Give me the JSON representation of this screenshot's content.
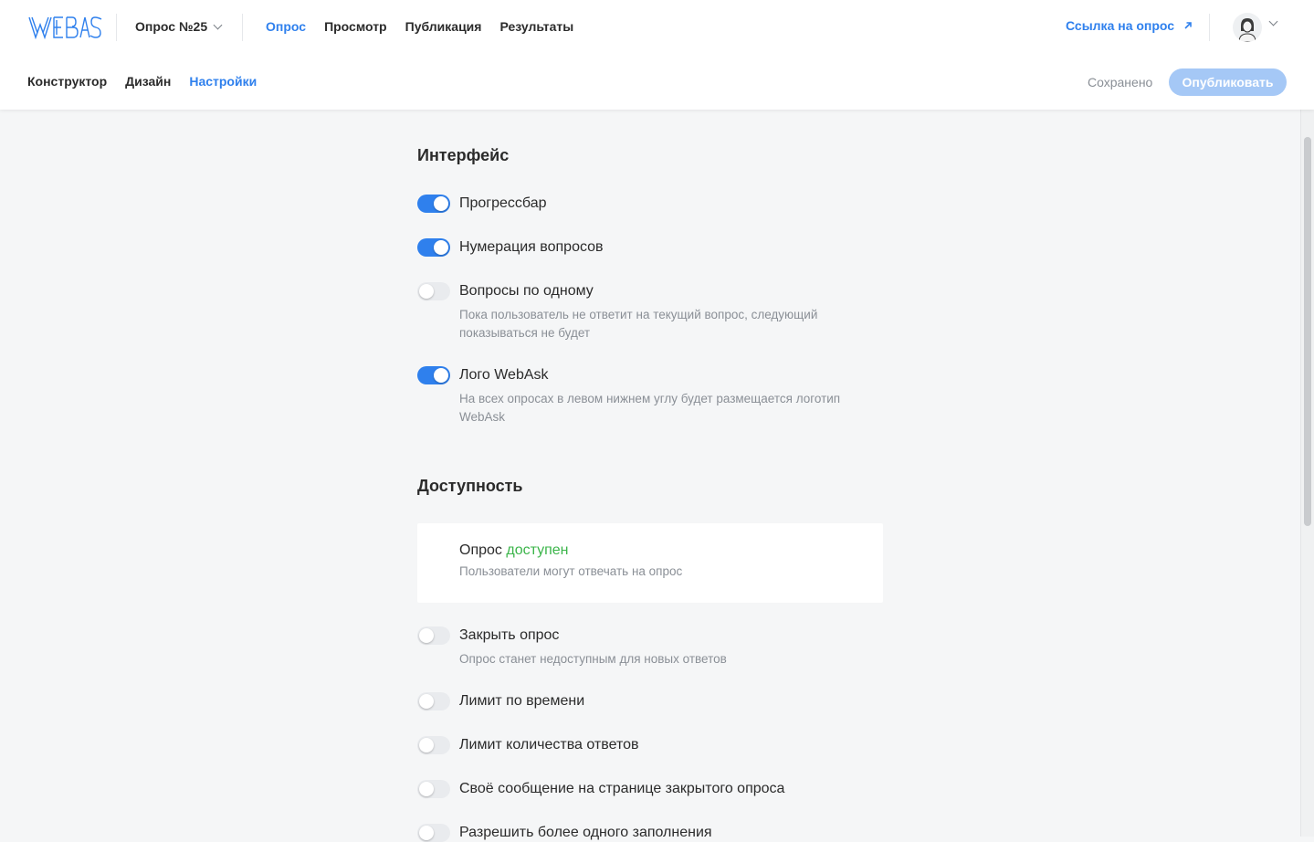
{
  "header": {
    "survey_name": "Опрос №25",
    "nav_tabs": [
      {
        "label": "Опрос",
        "active": true
      },
      {
        "label": "Просмотр",
        "active": false
      },
      {
        "label": "Публикация",
        "active": false
      },
      {
        "label": "Результаты",
        "active": false
      }
    ],
    "survey_link_label": "Ссылка на опрос",
    "sub_tabs": [
      {
        "label": "Конструктор",
        "active": false
      },
      {
        "label": "Дизайн",
        "active": false
      },
      {
        "label": "Настройки",
        "active": true
      }
    ],
    "save_status": "Сохранено",
    "publish_label": "Опубликовать"
  },
  "interface": {
    "title": "Интерфейс",
    "options": [
      {
        "label": "Прогрессбар",
        "enabled": true
      },
      {
        "label": "Нумерация вопросов",
        "enabled": true
      },
      {
        "label": "Вопросы по одному",
        "enabled": false,
        "description": "Пока пользователь не ответит на текущий вопрос, следующий показываться не будет"
      },
      {
        "label": "Лого WebAsk",
        "enabled": true,
        "description": "На всех опросах в левом нижнем углу будет размещается логотип WebAsk"
      }
    ]
  },
  "availability": {
    "title": "Доступность",
    "status_prefix": "Опрос",
    "status_value": "доступен",
    "status_description": "Пользователи могут отвечать на опрос",
    "options": [
      {
        "label": "Закрыть опрос",
        "enabled": false,
        "description": "Опрос станет недоступным для новых ответов"
      },
      {
        "label": "Лимит по времени",
        "enabled": false
      },
      {
        "label": "Лимит количества ответов",
        "enabled": false
      },
      {
        "label": "Своё сообщение на странице закрытого опроса",
        "enabled": false
      },
      {
        "label": "Разрешить более одного заполнения",
        "enabled": false
      }
    ]
  },
  "colors": {
    "accent": "#2f80ed",
    "success": "#3bb54a",
    "publish_button": "#a5c8f6"
  }
}
